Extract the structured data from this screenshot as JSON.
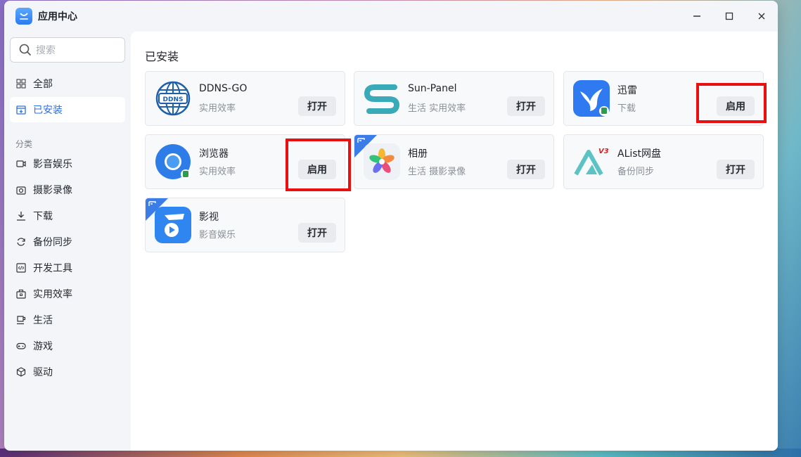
{
  "window": {
    "title": "应用中心"
  },
  "search": {
    "placeholder": "搜索"
  },
  "sidebar": {
    "items": [
      {
        "label": "全部",
        "icon": "grid-icon"
      },
      {
        "label": "已安装",
        "icon": "installed-icon"
      }
    ],
    "section_label": "分类",
    "categories": [
      {
        "label": "影音娱乐",
        "icon": "video-icon"
      },
      {
        "label": "摄影录像",
        "icon": "camera-icon"
      },
      {
        "label": "下载",
        "icon": "download-icon"
      },
      {
        "label": "备份同步",
        "icon": "sync-icon"
      },
      {
        "label": "开发工具",
        "icon": "code-icon"
      },
      {
        "label": "实用效率",
        "icon": "toolbox-icon"
      },
      {
        "label": "生活",
        "icon": "cup-icon"
      },
      {
        "label": "游戏",
        "icon": "gamepad-icon"
      },
      {
        "label": "驱动",
        "icon": "cube-icon"
      }
    ]
  },
  "main": {
    "title": "已安装",
    "apps": [
      {
        "name": "DDNS-GO",
        "category": "实用效率",
        "action": "打开",
        "icon": "ddns-globe-icon"
      },
      {
        "name": "Sun-Panel",
        "category": "生活 实用效率",
        "action": "打开",
        "icon": "sun-panel-icon"
      },
      {
        "name": "迅雷",
        "category": "下载",
        "action": "启用",
        "icon": "xunlei-bird-icon"
      },
      {
        "name": "浏览器",
        "category": "实用效率",
        "action": "启用",
        "icon": "browser-icon"
      },
      {
        "name": "相册",
        "category": "生活 摄影录像",
        "action": "打开",
        "icon": "photos-flower-icon"
      },
      {
        "name": "AList网盘",
        "category": "备份同步",
        "action": "打开",
        "icon": "alist-icon"
      },
      {
        "name": "影视",
        "category": "影音娱乐",
        "action": "打开",
        "icon": "video-player-icon"
      }
    ]
  },
  "colors": {
    "accent": "#2a6fe0",
    "highlight": "#e81010",
    "corner_tag": "#3b7de8"
  }
}
